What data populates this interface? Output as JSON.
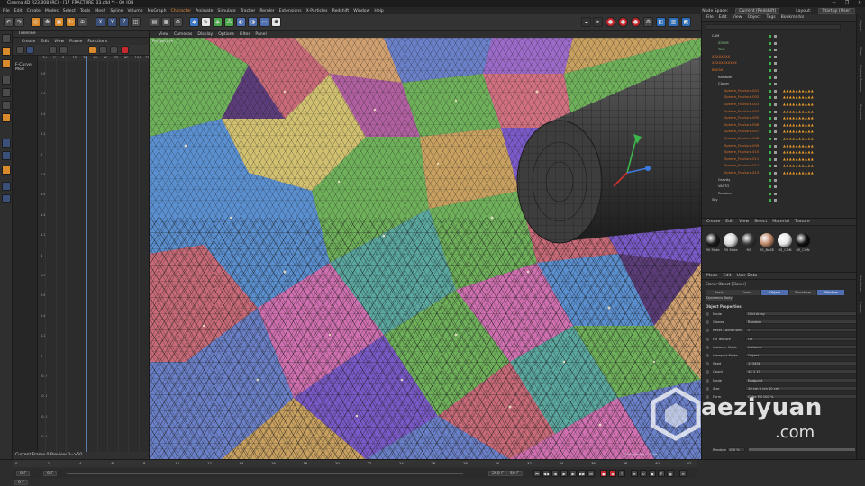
{
  "titlebar": {
    "title": "Cinema 4D R23.008 (RC) - [17_FRACTURE_03.c4d *] - 00_JOB",
    "controls": [
      "—",
      "❐",
      "✕"
    ]
  },
  "menubar": {
    "items": [
      "File",
      "Edit",
      "Create",
      "Modes",
      "Select",
      "Tools",
      "Mesh",
      "Spline",
      "Volume",
      "MoGraph",
      "Character",
      "Animate",
      "Simulate",
      "Tracker",
      "Render",
      "Extensions",
      "X-Particles",
      "Redshift",
      "Window",
      "Help"
    ],
    "highlighted": "Character",
    "node_space_label": "Node Space:",
    "node_space_value": "Current (Redshift)",
    "layout_label": "Layout:",
    "layout_value": "Startup (User)"
  },
  "timeline": {
    "title": "Timeline",
    "menu": [
      "Create",
      "Edit",
      "View",
      "Frame",
      "Functions"
    ],
    "left_label": "F-Curve Mod",
    "ruler": [
      "-30",
      "-15",
      "0",
      "15",
      "30",
      "45",
      "60",
      "75",
      "90",
      "105",
      "120"
    ],
    "y_ticks": [
      "2.8",
      "2.6",
      "2.4",
      "2.2",
      "2",
      "1.8",
      "1.6",
      "1.4",
      "1.2",
      "1",
      "0.8",
      "0.6",
      "0.4",
      "0.2",
      "0",
      "-0.2",
      "-0.4",
      "-0.6",
      "-0.8"
    ],
    "footer": "Current Frame  0   Preview  0-->50"
  },
  "viewport": {
    "menu": [
      "View",
      "Cameras",
      "Display",
      "Options",
      "Filter",
      "Panel"
    ],
    "label": "Perspective",
    "grid_spacing": "Grid Spacing : 10 cm"
  },
  "object_manager": {
    "menu": [
      "File",
      "Edit",
      "View",
      "Object",
      "Tags",
      "Bookmarks"
    ],
    "objects": [
      {
        "name": "CAM",
        "indent": 1,
        "color": "#cfcfcf"
      },
      {
        "name": "ZOOM",
        "indent": 2,
        "color": "#8fd08f"
      },
      {
        "name": "TILE",
        "indent": 2,
        "color": "#8fd08f"
      },
      {
        "name": "XXXXXXXX",
        "indent": 1,
        "color": "#e0732a"
      },
      {
        "name": "XXXXXXXXXXX",
        "indent": 1,
        "color": "#e0732a"
      },
      {
        "name": "BREAK",
        "indent": 1,
        "color": "#e0732a"
      },
      {
        "name": "Random",
        "indent": 2,
        "color": "#cfcfcf"
      },
      {
        "name": "Cloner",
        "indent": 2,
        "color": "#cfcfcf"
      },
      {
        "name": "Sphere_Fracture.001",
        "indent": 3,
        "color": "#e0732a"
      },
      {
        "name": "Sphere_Fracture.002",
        "indent": 3,
        "color": "#e0732a"
      },
      {
        "name": "Sphere_Fracture.003",
        "indent": 3,
        "color": "#e0732a"
      },
      {
        "name": "Sphere_Fracture.004",
        "indent": 3,
        "color": "#e0732a"
      },
      {
        "name": "Sphere_Fracture.005",
        "indent": 3,
        "color": "#e0732a"
      },
      {
        "name": "Sphere_Fracture.006",
        "indent": 3,
        "color": "#e0732a"
      },
      {
        "name": "Sphere_Fracture.007",
        "indent": 3,
        "color": "#e0732a"
      },
      {
        "name": "Sphere_Fracture.008",
        "indent": 3,
        "color": "#e0732a"
      },
      {
        "name": "Sphere_Fracture.009",
        "indent": 3,
        "color": "#e0732a"
      },
      {
        "name": "Sphere_Fracture.010",
        "indent": 3,
        "color": "#e0732a"
      },
      {
        "name": "Sphere_Fracture.011",
        "indent": 3,
        "color": "#e0732a"
      },
      {
        "name": "Sphere_Fracture.012",
        "indent": 3,
        "color": "#e0732a"
      },
      {
        "name": "Sphere_Fracture.013",
        "indent": 3,
        "color": "#e0732a"
      },
      {
        "name": "Gravity",
        "indent": 2,
        "color": "#cfcfcf"
      },
      {
        "name": "VASTO",
        "indent": 2,
        "color": "#cfcfcf"
      },
      {
        "name": "Random",
        "indent": 2,
        "color": "#cfcfcf"
      },
      {
        "name": "Sky",
        "indent": 1,
        "color": "#cfcfcf"
      }
    ]
  },
  "material_manager": {
    "menu": [
      "Create",
      "Edit",
      "View",
      "Select",
      "Material",
      "Texture"
    ],
    "materials": [
      {
        "name": "RS Mate",
        "color": "#1d1d1d"
      },
      {
        "name": "RS Mate",
        "color": "#d8d8d8"
      },
      {
        "name": "RS",
        "color": "#3a3a3a"
      },
      {
        "name": "RS_BASE",
        "color": "#c08a6a"
      },
      {
        "name": "RS_CON",
        "color": "#e8e8e8"
      },
      {
        "name": "RS_CON",
        "color": "#111111"
      }
    ]
  },
  "attribute_manager": {
    "menu": [
      "Mode",
      "Edit",
      "User Data"
    ],
    "object_title": "Cloner Object [Cloner]",
    "tabs": [
      "Basic",
      "Coord.",
      "Object",
      "Transform",
      "Effectors"
    ],
    "active_tab": "Object",
    "subheader": "Dynamics Body",
    "section": "Object Properties",
    "rows": [
      {
        "label": "Mode",
        "value": "Grid Array"
      },
      {
        "label": "Clones",
        "value": "Random"
      },
      {
        "label": "Reset Coordinates",
        "value": "✓"
      },
      {
        "label": "Fix Texture",
        "value": "Off"
      },
      {
        "label": "Instance Mode",
        "value": "Instance"
      },
      {
        "label": "Viewport Mode",
        "value": "Object"
      },
      {
        "label": "Seed",
        "value": "123456"
      },
      {
        "label": "Count",
        "value": "44     1     15"
      },
      {
        "label": "Mode",
        "value": "Endpoint"
      },
      {
        "label": "Size",
        "value": "10 cm     0 cm     10 cm"
      },
      {
        "label": "Form",
        "value": "Cube    Fill  100 %"
      }
    ],
    "footer_label": "Random",
    "footer_value": "100 %"
  },
  "right_strip": [
    "Objects",
    "Takes",
    "Content Browser",
    "Structure",
    "Attributes",
    "Layers"
  ],
  "bottom": {
    "ruler": [
      "0",
      "2",
      "4",
      "6",
      "8",
      "10",
      "12",
      "14",
      "16",
      "18",
      "20",
      "22",
      "24",
      "26",
      "28",
      "30",
      "32",
      "34",
      "36",
      "38",
      "40",
      "42"
    ],
    "start_frame": "0 F",
    "end_frame": "0 F",
    "min": "0 F",
    "max": "250 F",
    "fps": "50 F"
  },
  "watermark": {
    "main": "aeziyuan",
    "sub": ".com"
  },
  "colors": {
    "accent": "#e58c3a",
    "tab_active": "#4f6fb0"
  }
}
